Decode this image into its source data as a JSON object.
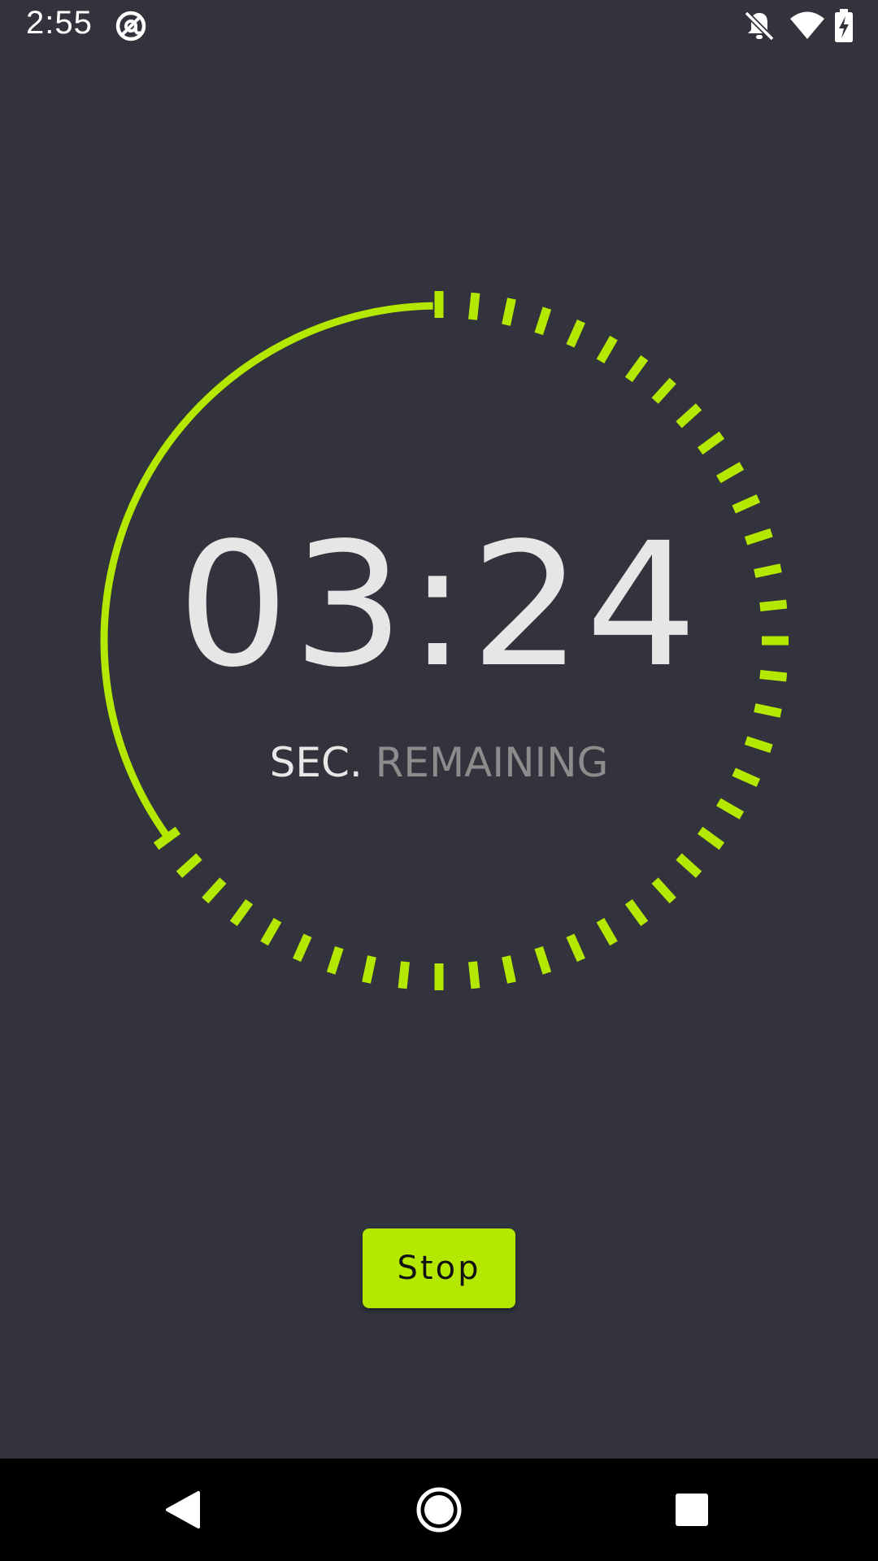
{
  "status_bar": {
    "time": "2:55",
    "icons": [
      "at-sign-icon",
      "notifications-off-icon",
      "wifi-icon",
      "battery-charging-icon"
    ]
  },
  "timer": {
    "time_text": "03:24",
    "label_sec": "SEC.",
    "label_remaining": "REMAINING",
    "elapsed_fraction": 0.35,
    "tick_count": 60,
    "accent_color": "#b4e800"
  },
  "controls": {
    "stop_label": "Stop"
  },
  "nav_bar": {
    "buttons": [
      "back-icon",
      "home-icon",
      "recents-icon"
    ]
  },
  "colors": {
    "background": "#33333d",
    "accent": "#b4e800",
    "nav_background": "#000000"
  }
}
